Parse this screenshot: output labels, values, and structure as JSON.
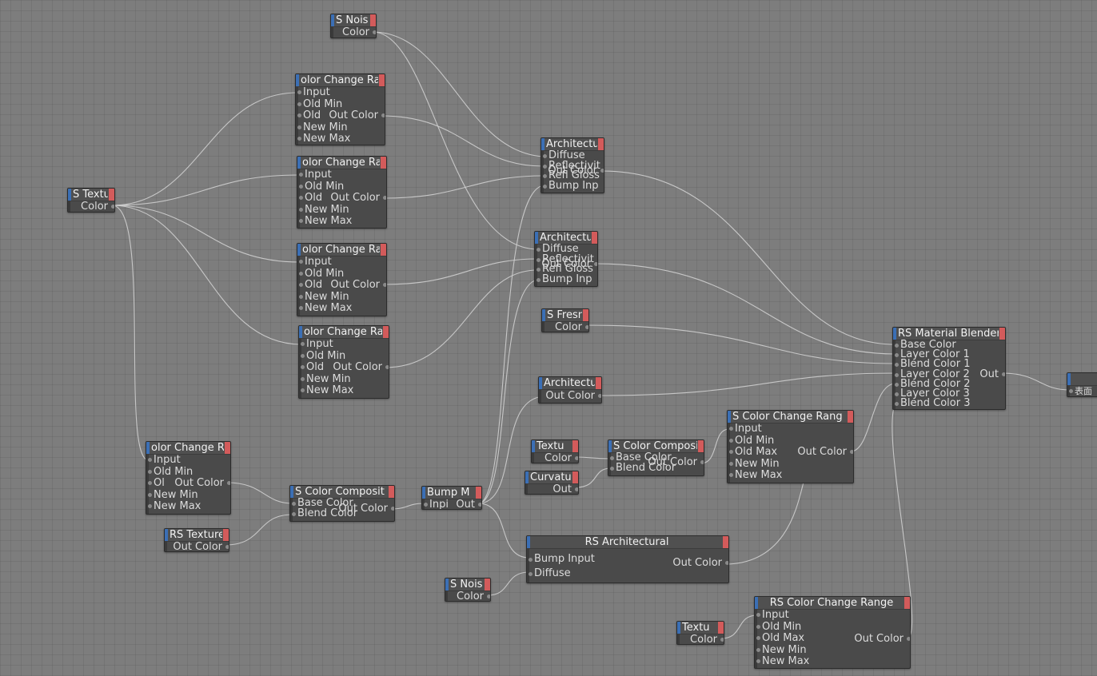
{
  "colors": {
    "background": "#7d7d7d",
    "node_body": "#4a4a4a",
    "node_header": "#505050",
    "input_tab": "#3b6fb5",
    "output_tab": "#d35b5b",
    "wire": "#cfcfcf"
  },
  "nodes": {
    "noise_top": {
      "title": "S Nois",
      "out": "Color"
    },
    "texture_left": {
      "title": "S Textu",
      "out": "Color"
    },
    "ccr1": {
      "title": "olor Change Ra",
      "inputs": [
        "Input",
        "Old Min",
        "Old",
        "New Min",
        "New Max"
      ],
      "out": "Out Color"
    },
    "ccr2": {
      "title": "olor Change Ra",
      "inputs": [
        "Input",
        "Old Min",
        "Old",
        "New Min",
        "New Max"
      ],
      "out": "Out Color"
    },
    "ccr3": {
      "title": "olor Change Ra",
      "inputs": [
        "Input",
        "Old Min",
        "Old",
        "New Min",
        "New Max"
      ],
      "out": "Out Color"
    },
    "ccr4": {
      "title": "olor Change Ra",
      "inputs": [
        "Input",
        "Old Min",
        "Old",
        "New Min",
        "New Max"
      ],
      "out": "Out Color"
    },
    "ccr5": {
      "title": "olor Change R",
      "inputs": [
        "Input",
        "Old Min",
        "Ol",
        "New Min",
        "New Max"
      ],
      "out": "Out Color"
    },
    "arch1": {
      "title": "Architectu",
      "inputs": [
        "Diffuse",
        "Reflectivit",
        "Refl Gloss",
        "Bump Inp"
      ],
      "out": "Out Color"
    },
    "arch2": {
      "title": "Architectu",
      "inputs": [
        "Diffuse",
        "Reflectivit",
        "Refl Gloss",
        "Bump Inp"
      ],
      "out": "Out Color"
    },
    "fresnel": {
      "title": "S Fresn",
      "out": "Color"
    },
    "arch3": {
      "title": "Architectu",
      "out": "Out Color"
    },
    "texture_mid": {
      "title": "Textu",
      "out": "Color"
    },
    "curvature": {
      "title": "Curvatu",
      "out": "Out"
    },
    "composite_mid": {
      "title": "S Color Composi",
      "inputs": [
        "Base Color",
        "Blend Color"
      ],
      "out": "Out Color"
    },
    "ccr_big": {
      "title": "S Color Change Rang",
      "inputs": [
        "Input",
        "Old Min",
        "Old Max",
        "New Min",
        "New Max"
      ],
      "out": "Out Color"
    },
    "blender": {
      "title": "RS Material Blender",
      "inputs": [
        "Base Color",
        "Layer Color 1",
        "Blend Color 1",
        "Layer Color 2",
        "Blend Color 2",
        "Layer Color 3",
        "Blend Color 3"
      ],
      "out": "Out"
    },
    "output_end": {
      "title": "",
      "in": "表面"
    },
    "composite_low": {
      "title": "S Color Composit",
      "inputs": [
        "Base Color",
        "Blend Color"
      ],
      "out": "Out Color"
    },
    "texture_low": {
      "title": "RS Texture",
      "out": "Out Color"
    },
    "bump": {
      "title": "Bump M",
      "inputs": [
        "Inpi"
      ],
      "out": "Out"
    },
    "arch_big": {
      "title": "RS Architectural",
      "inputs": [
        "Bump Input",
        "Diffuse"
      ],
      "out": "Out Color"
    },
    "noise_low": {
      "title": "S Nois",
      "out": "Color"
    },
    "texture_bottom": {
      "title": "Textu",
      "out": "Color"
    },
    "ccr_bottom": {
      "title": "RS Color Change Range",
      "inputs": [
        "Input",
        "Old Min",
        "Old Max",
        "New Min",
        "New Max"
      ],
      "out": "Out Color"
    }
  }
}
